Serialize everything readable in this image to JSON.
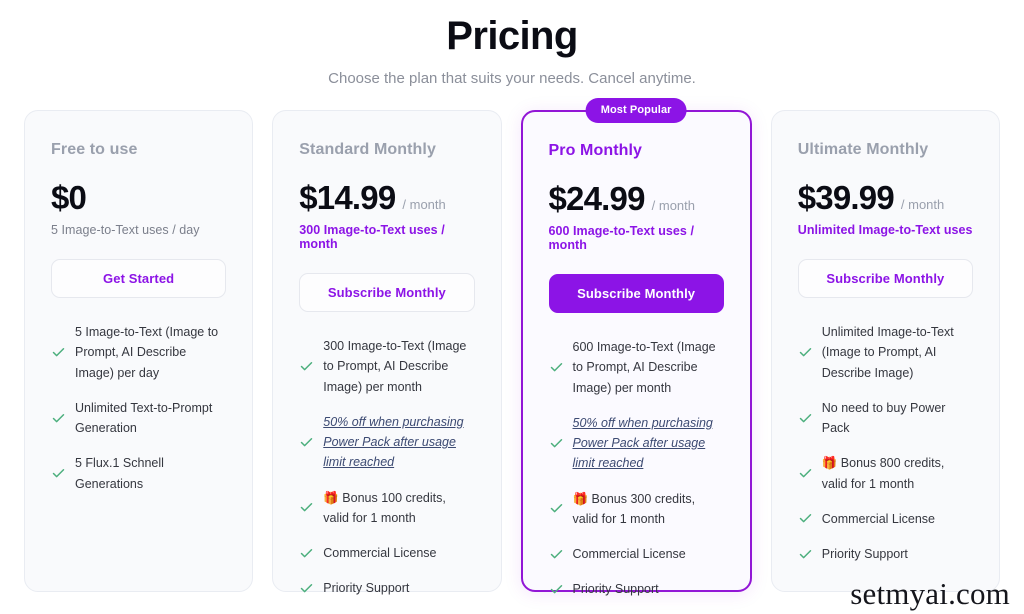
{
  "header": {
    "title": "Pricing",
    "subtitle": "Choose the plan that suits your needs. Cancel anytime."
  },
  "badge_label": "Most Popular",
  "colors": {
    "accent": "#8c14e6",
    "featured_border": "#9216d6",
    "check": "#4caf7d",
    "link": "#3c4a72",
    "card_bg": "#f9fafc",
    "title": "#0b0c14",
    "muted": "#9aa0ad"
  },
  "plans": [
    {
      "name": "Free to use",
      "price": "$0",
      "period": "",
      "quota": "5 Image-to-Text uses / day",
      "quota_style": "muted",
      "cta": "Get Started",
      "featured": false,
      "features": [
        {
          "text": "5 Image-to-Text (Image to Prompt, AI Describe Image) per day",
          "style": "plain"
        },
        {
          "text": "Unlimited Text-to-Prompt Generation",
          "style": "plain"
        },
        {
          "text": "5 Flux.1 Schnell Generations",
          "style": "plain"
        }
      ]
    },
    {
      "name": "Standard Monthly",
      "price": "$14.99",
      "period": "/ month",
      "quota": "300 Image-to-Text uses / month",
      "quota_style": "accent",
      "cta": "Subscribe Monthly",
      "featured": false,
      "features": [
        {
          "text": "300 Image-to-Text (Image to Prompt, AI Describe Image) per month",
          "style": "plain"
        },
        {
          "text": "50% off when purchasing Power Pack after usage limit reached",
          "style": "link"
        },
        {
          "text": "🎁 Bonus 100 credits, valid for 1 month",
          "style": "plain"
        },
        {
          "text": "Commercial License",
          "style": "plain"
        },
        {
          "text": "Priority Support",
          "style": "plain"
        }
      ]
    },
    {
      "name": "Pro Monthly",
      "price": "$24.99",
      "period": "/ month",
      "quota": "600 Image-to-Text uses / month",
      "quota_style": "accent",
      "cta": "Subscribe Monthly",
      "featured": true,
      "features": [
        {
          "text": "600 Image-to-Text (Image to Prompt, AI Describe Image) per month",
          "style": "plain"
        },
        {
          "text": "50% off when purchasing Power Pack after usage limit reached",
          "style": "link"
        },
        {
          "text": "🎁 Bonus 300 credits, valid for 1 month",
          "style": "plain"
        },
        {
          "text": "Commercial License",
          "style": "plain"
        },
        {
          "text": "Priority Support",
          "style": "plain"
        }
      ]
    },
    {
      "name": "Ultimate Monthly",
      "price": "$39.99",
      "period": "/ month",
      "quota": "Unlimited Image-to-Text uses",
      "quota_style": "accent",
      "cta": "Subscribe Monthly",
      "featured": false,
      "features": [
        {
          "text": "Unlimited Image-to-Text (Image to Prompt, AI Describe Image)",
          "style": "plain"
        },
        {
          "text": "No need to buy Power Pack",
          "style": "plain"
        },
        {
          "text": "🎁 Bonus 800 credits, valid for 1 month",
          "style": "plain"
        },
        {
          "text": "Commercial License",
          "style": "plain"
        },
        {
          "text": "Priority Support",
          "style": "plain"
        }
      ]
    }
  ],
  "watermark": "setmyai.com"
}
